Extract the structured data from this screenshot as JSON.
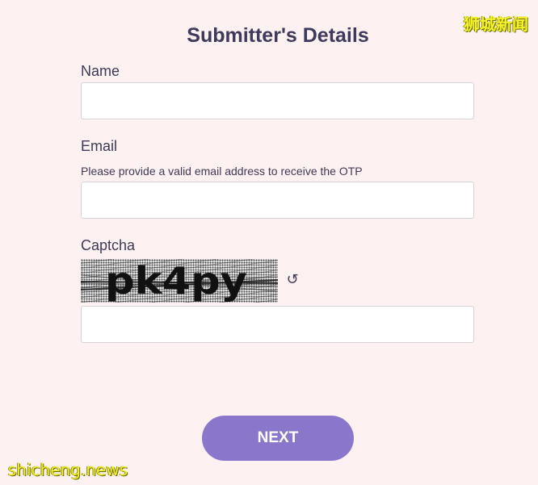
{
  "form": {
    "title": "Submitter's Details",
    "name_label": "Name",
    "name_value": "",
    "email_label": "Email",
    "email_hint": "Please provide a valid email address to receive the OTP",
    "email_value": "",
    "captcha_label": "Captcha",
    "captcha_text": "pk4py",
    "captcha_value": "",
    "refresh_glyph": "↺",
    "next_label": "NEXT"
  },
  "icons": {
    "refresh": "refresh-icon"
  },
  "watermarks": {
    "top_right": "狮城新闻",
    "bottom_left": "shicheng.news"
  },
  "colors": {
    "background": "#fdf1f1",
    "accent": "#8a77cb",
    "text": "#3d3a5c",
    "watermark": "#f4ef2e"
  }
}
